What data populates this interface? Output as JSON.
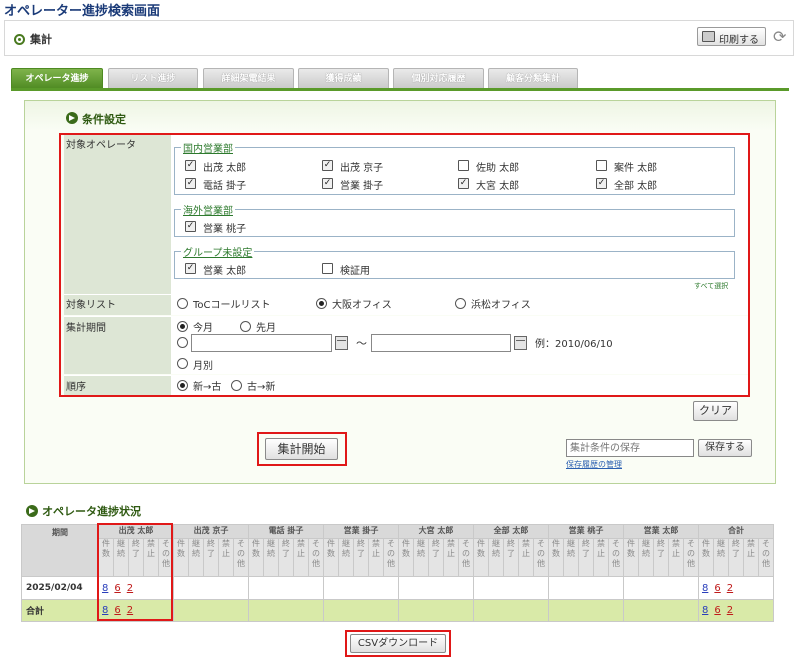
{
  "page": {
    "title": "オペレーター進捗検索画面"
  },
  "header": {
    "title": "集計",
    "print_label": "印刷する"
  },
  "tabs": [
    {
      "label": "オペレータ進捗",
      "active": true
    },
    {
      "label": "リスト進捗",
      "active": false
    },
    {
      "label": "詳細架電結果",
      "active": false
    },
    {
      "label": "獲得成績",
      "active": false
    },
    {
      "label": "個別対応履歴",
      "active": false
    },
    {
      "label": "顧客分類集計",
      "active": false
    }
  ],
  "conditions": {
    "title": "条件設定",
    "operator_label": "対象オペレータ",
    "groups": [
      {
        "name": "国内営業部",
        "members": [
          {
            "name": "出茂 太郎",
            "checked": true
          },
          {
            "name": "出茂 京子",
            "checked": true
          },
          {
            "name": "佐助 太郎",
            "checked": false
          },
          {
            "name": "案件 太郎",
            "checked": false
          },
          {
            "name": "電話 掛子",
            "checked": true
          },
          {
            "name": "営業 掛子",
            "checked": true
          },
          {
            "name": "大宮 太郎",
            "checked": true
          },
          {
            "name": "全部 太郎",
            "checked": true
          }
        ]
      },
      {
        "name": "海外営業部",
        "members": [
          {
            "name": "営業 桃子",
            "checked": true
          }
        ]
      },
      {
        "name": "グループ未設定",
        "members": [
          {
            "name": "営業 太郎",
            "checked": true
          },
          {
            "name": "検証用",
            "checked": false
          }
        ]
      }
    ],
    "select_all": "すべて選択",
    "list_label": "対象リスト",
    "list_options": [
      {
        "label": "ToCコールリスト",
        "selected": false
      },
      {
        "label": "大阪オフィス",
        "selected": true
      },
      {
        "label": "浜松オフィス",
        "selected": false
      }
    ],
    "period_label": "集計期間",
    "period_this_month": "今月",
    "period_last_month": "先月",
    "period_tilde": "～",
    "period_example": "例：2010/06/10",
    "period_monthly": "月別",
    "order_label": "順序",
    "order_new_old": "新→古",
    "order_old_new": "古→新",
    "clear_button": "クリア",
    "start_button": "集計開始",
    "save_placeholder": "集計条件の保存",
    "save_button": "保存する",
    "save_history_link": "保存履歴の管理"
  },
  "status": {
    "title": "オペレータ進捗状況",
    "period_header": "期間",
    "operators": [
      "出茂 太郎",
      "出茂 京子",
      "電話 掛子",
      "営業 掛子",
      "大宮 太郎",
      "全部 太郎",
      "営業 桃子",
      "営業 太郎",
      "合計"
    ],
    "sub_headers": [
      "件数",
      "継続",
      "終了",
      "禁止",
      "その他"
    ],
    "rows": [
      {
        "label": "2025/02/04",
        "first": [
          "8",
          "6",
          "2"
        ],
        "total": [
          "8",
          "6",
          "2"
        ]
      },
      {
        "label": "合計",
        "first": [
          "8",
          "6",
          "2"
        ],
        "total": [
          "8",
          "6",
          "2"
        ]
      }
    ],
    "csv_button": "CSVダウンロード"
  },
  "colors": {
    "accent": "#4e8a22",
    "highlight_box": "#e01818",
    "total_row": "#d9eaa8"
  }
}
